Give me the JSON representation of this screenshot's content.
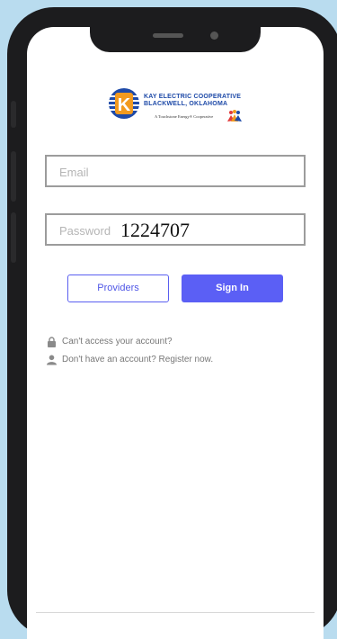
{
  "logo": {
    "line1": "KAY ELECTRIC COOPERATIVE",
    "line2": "BLACKWELL, OKLAHOMA",
    "tagline": "A Touchstone Energy® Cooperative",
    "letter": "K"
  },
  "login": {
    "email_placeholder": "Email",
    "email_value": "",
    "password_placeholder": "Password",
    "password_value": "1224707"
  },
  "buttons": {
    "providers": "Providers",
    "sign_in": "Sign In"
  },
  "links": {
    "access": "Can't access your account?",
    "register": "Don't have an account? Register now."
  },
  "colors": {
    "accent": "#5b5ff5",
    "brand_blue": "#1e4aa8",
    "brand_orange": "#f29a1f",
    "background": "#b9dcef"
  }
}
